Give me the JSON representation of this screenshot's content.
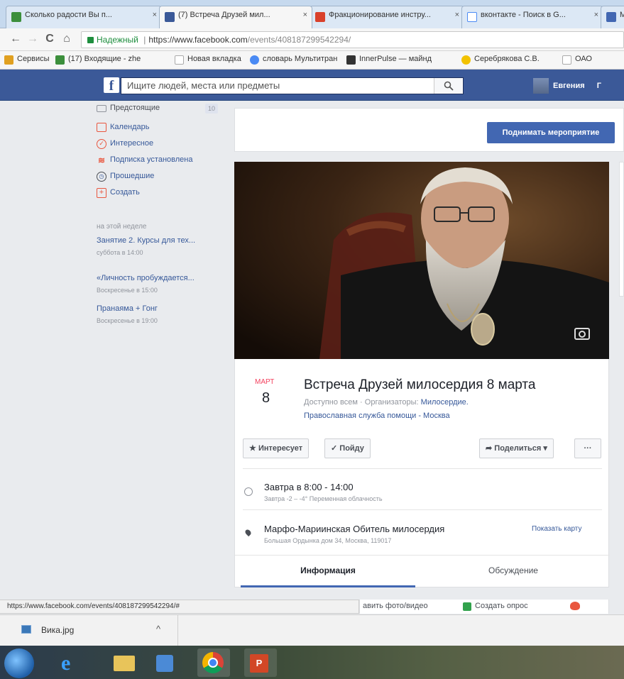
{
  "browser": {
    "tabs": [
      {
        "title": "Сколько радости Вы п...",
        "fav": "#3c8f3c",
        "close": "×"
      },
      {
        "title": "(7) Встреча Друзей мил...",
        "fav": "#3b5998",
        "close": "×"
      },
      {
        "title": "Фракционирование инстру...",
        "fav": "#d9412b",
        "close": "×"
      },
      {
        "title": "вконтакте - Поиск в G...",
        "fav": "#4a8af4",
        "close": "×"
      },
      {
        "title": "M",
        "fav": "#4267b2",
        "close": ""
      }
    ],
    "nav": {
      "back": "←",
      "forward": "→",
      "reload": "C",
      "home": "⌂"
    },
    "address": {
      "secure_label": "Надежный",
      "url_prefix": "https://www.facebook.com",
      "url_path": "/events/408187299542294/"
    },
    "bookmarks": [
      {
        "label": "Сервисы",
        "color": "#e0a020"
      },
      {
        "label": "(17) Входящие - zhe",
        "color": "#3c8f3c"
      },
      {
        "label": "Новая вкладка",
        "color": "#cccccc"
      },
      {
        "label": "словарь Мультитран",
        "color": "#4a8af4"
      },
      {
        "label": "InnerPulse — майнд",
        "color": "#333333"
      },
      {
        "label": "Серебрякова С.В.",
        "color": "#f2c200"
      },
      {
        "label": "ОАО",
        "color": "#cccccc"
      }
    ]
  },
  "fb": {
    "logo": "f",
    "search_placeholder": "Ищите людей, места или предметы",
    "search_icon": "magnifier-icon",
    "user_name": "Евгения",
    "user_more": "Г"
  },
  "sidebar": {
    "items": [
      {
        "label": "Предстоящие",
        "icon": "calendar-upcoming-icon",
        "badge": "10"
      },
      {
        "label": "Календарь",
        "icon": "calendar-icon"
      },
      {
        "label": "Интересное",
        "icon": "discover-icon"
      },
      {
        "label": "Подписка установлена",
        "icon": "subscription-icon"
      },
      {
        "label": "Прошедшие",
        "icon": "clock-icon"
      },
      {
        "label": "Создать",
        "icon": "create-icon"
      }
    ],
    "week_label": "на этой неделе",
    "events": [
      {
        "title": "Занятие 2. Курсы для тех...",
        "when": "суббота в 14:00"
      },
      {
        "title": "«Личность пробуждается...",
        "when": "Воскресенье в 15:00"
      },
      {
        "title": "Пранаяма + Гонг",
        "when": "Воскресенье в 19:00"
      }
    ]
  },
  "event": {
    "promote_button": "Поднимать мероприятие",
    "month": "МАРТ",
    "day": "8",
    "title": "Встреча Друзей милосердия 8 марта",
    "access": "Доступно всем",
    "separator": "·",
    "organizers_label": "Организаторы:",
    "organizer_line1": "Милосердие.",
    "organizer_line2": "Православная служба помощи - Москва",
    "interested_button": "Интересует",
    "going_button": "Пойду",
    "share_button": "Поделиться",
    "more_button": "···",
    "time_main": "Завтра в 8:00 - 14:00",
    "time_sub": "Завтра  -2 – -4° Переменная облачность",
    "place_main": "Марфо-Мариинская Обитель милосердия",
    "place_sub": "Большая Ордынка дом 34, Москва, 119017",
    "show_map": "Показать карту",
    "tab_info": "Информация",
    "tab_discussion": "Обсуждение",
    "bottom_photo": "авить фото/видео",
    "bottom_poll": "Создать опрос"
  },
  "status_url": "https://www.facebook.com/events/408187299542294/#",
  "downloads": {
    "file": "Вика.jpg",
    "chevron": "^"
  },
  "taskbar": [
    "start-button",
    "ie-icon",
    "explorer-icon",
    "media-icon",
    "chrome-icon",
    "powerpoint-icon"
  ],
  "colors": {
    "fb_blue": "#3b5998",
    "link": "#365899",
    "date_red": "#f3425f",
    "button_blue": "#4267b2"
  }
}
